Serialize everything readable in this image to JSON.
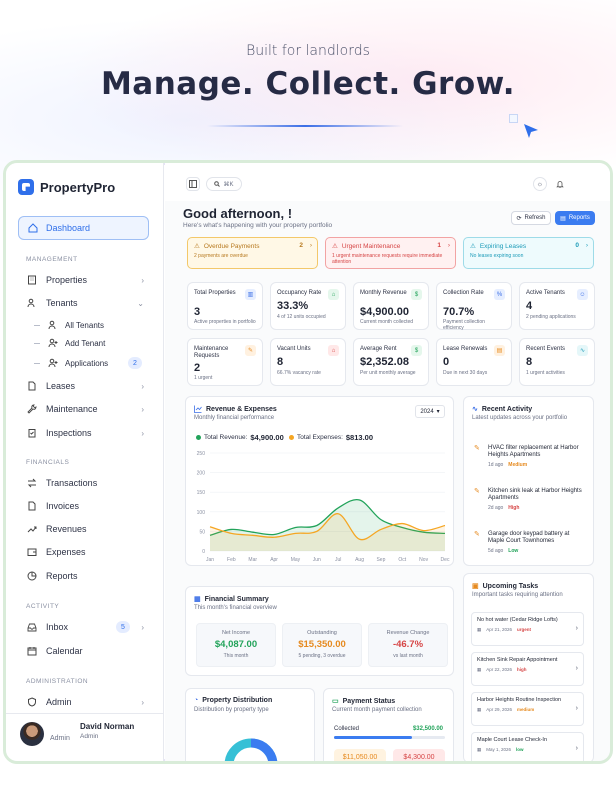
{
  "hero": {
    "subtitle": "Built for landlords",
    "title": "Manage. Collect. Grow."
  },
  "app": {
    "name": "PropertyPro"
  },
  "sidebar": {
    "active_item": "Dashboard",
    "sections": {
      "management": "MANAGEMENT",
      "financials": "FINANCIALS",
      "activity": "ACTIVITY",
      "administration": "ADMINISTRATION"
    },
    "items": {
      "properties": "Properties",
      "tenants": "Tenants",
      "all_tenants": "All Tenants",
      "add_tenant": "Add Tenant",
      "applications": "Applications",
      "applications_count": "2",
      "leases": "Leases",
      "maintenance": "Maintenance",
      "inspections": "Inspections",
      "transactions": "Transactions",
      "invoices": "Invoices",
      "revenues": "Revenues",
      "expenses": "Expenses",
      "reports": "Reports",
      "inbox": "Inbox",
      "inbox_count": "5",
      "calendar": "Calendar",
      "admin": "Admin"
    },
    "user": {
      "name": "David Norman",
      "role": "Admin",
      "role_left": "Admin"
    }
  },
  "topbar": {
    "search_shortcut": "⌘K"
  },
  "header": {
    "greeting": "Good afternoon, !",
    "subtitle": "Here's what's happening with your property portfolio",
    "refresh_label": "Refresh",
    "reports_label": "Reports"
  },
  "alerts": [
    {
      "title": "Overdue Payments",
      "count": "2",
      "sub": "2 payments are overdue",
      "bg": "#fff8e6",
      "border": "#f3c86a",
      "color": "#b7791f"
    },
    {
      "title": "Urgent Maintenance",
      "count": "1",
      "sub": "1 urgent maintenance requests require immediate attention",
      "bg": "#fff1f1",
      "border": "#f2a3a3",
      "color": "#d64545"
    },
    {
      "title": "Expiring Leases",
      "count": "0",
      "sub": "No leases expiring soon",
      "bg": "#eefbfd",
      "border": "#9edbe8",
      "color": "#1b9bb8"
    }
  ],
  "stats": [
    {
      "label": "Total Properties",
      "value": "3",
      "sub": "Active properties in portfolio",
      "icon": "building-icon",
      "icon_bg": "#e6eeff",
      "icon_color": "#3b6ee6"
    },
    {
      "label": "Occupancy Rate",
      "value": "33.3%",
      "sub": "4 of 12 units occupied",
      "icon": "home-icon",
      "icon_bg": "#e5f7ec",
      "icon_color": "#22a35a"
    },
    {
      "label": "Monthly Revenue",
      "value": "$4,900.00",
      "sub": "Current month collected",
      "icon": "dollar-icon",
      "icon_bg": "#e5f7ec",
      "icon_color": "#22a35a"
    },
    {
      "label": "Collection Rate",
      "value": "70.7%",
      "sub": "Payment collection efficiency",
      "icon": "percent-icon",
      "icon_bg": "#e6eeff",
      "icon_color": "#3b6ee6"
    },
    {
      "label": "Active Tenants",
      "value": "4",
      "sub": "2 pending applications",
      "icon": "users-icon",
      "icon_bg": "#e6eeff",
      "icon_color": "#3b6ee6"
    },
    {
      "label": "Maintenance Requests",
      "value": "2",
      "sub": "1 urgent",
      "icon": "wrench-icon",
      "icon_bg": "#fff1e0",
      "icon_color": "#e68a1f"
    },
    {
      "label": "Vacant Units",
      "value": "8",
      "sub": "66.7% vacancy rate",
      "icon": "home-icon",
      "icon_bg": "#ffe8e8",
      "icon_color": "#d64545"
    },
    {
      "label": "Average Rent",
      "value": "$2,352.08",
      "sub": "Per unit monthly average",
      "icon": "dollar-icon",
      "icon_bg": "#e5f7ec",
      "icon_color": "#22a35a"
    },
    {
      "label": "Lease Renewals",
      "value": "0",
      "sub": "Due in next 30 days",
      "icon": "file-icon",
      "icon_bg": "#fff1e0",
      "icon_color": "#e68a1f"
    },
    {
      "label": "Recent Events",
      "value": "8",
      "sub": "1 urgent activities",
      "icon": "activity-icon",
      "icon_bg": "#e5f7f9",
      "icon_color": "#1b9bb8"
    }
  ],
  "revenue_panel": {
    "title": "Revenue & Expenses",
    "subtitle": "Monthly financial performance",
    "year": "2024",
    "legend_revenue_label": "Total Revenue:",
    "legend_revenue_value": "$4,900.00",
    "legend_expenses_label": "Total Expenses:",
    "legend_expenses_value": "$813.00"
  },
  "chart_data": {
    "type": "area",
    "categories": [
      "Jan",
      "Feb",
      "Mar",
      "Apr",
      "May",
      "Jun",
      "Jul",
      "Aug",
      "Sep",
      "Oct",
      "Nov",
      "Dec"
    ],
    "ylim": [
      0,
      250
    ],
    "yticks": [
      0,
      50,
      100,
      150,
      200,
      250
    ],
    "grid": true,
    "series": [
      {
        "name": "Total Revenue",
        "color": "#22a35a",
        "values": [
          40,
          55,
          48,
          42,
          60,
          65,
          110,
          130,
          80,
          60,
          48,
          45
        ]
      },
      {
        "name": "Total Expenses",
        "color": "#f5a623",
        "values": [
          62,
          45,
          40,
          35,
          45,
          50,
          95,
          30,
          55,
          70,
          52,
          65
        ]
      }
    ]
  },
  "recent_activity": {
    "title": "Recent Activity",
    "subtitle": "Latest updates across your portfolio",
    "items": [
      {
        "text": "HVAC filter replacement at Harbor Heights Apartments",
        "time": "1d ago",
        "priority": "Medium",
        "priority_color": "#e68a1f"
      },
      {
        "text": "Kitchen sink leak at Harbor Heights Apartments",
        "time": "2d ago",
        "priority": "High",
        "priority_color": "#d64545"
      },
      {
        "text": "Garage door keypad battery at Maple Court Townhomes",
        "time": "5d ago",
        "priority": "Low",
        "priority_color": "#22a35a"
      }
    ]
  },
  "upcoming_tasks": {
    "title": "Upcoming Tasks",
    "subtitle": "Important tasks requiring attention",
    "items": [
      {
        "title": "No hot water (Cedar Ridge Lofts)",
        "date": "Apr 21, 2026",
        "priority": "urgent",
        "priority_color": "#d64545"
      },
      {
        "title": "Kitchen Sink Repair Appointment",
        "date": "Apr 22, 2026",
        "priority": "high",
        "priority_color": "#d64545"
      },
      {
        "title": "Harbor Heights Routine Inspection",
        "date": "Apr 29, 2026",
        "priority": "medium",
        "priority_color": "#e68a1f"
      },
      {
        "title": "Maple Court Lease Check-In",
        "date": "May 1, 2026",
        "priority": "low",
        "priority_color": "#22a35a"
      }
    ]
  },
  "financial_summary": {
    "title": "Financial Summary",
    "subtitle": "This month's financial overview",
    "cells": [
      {
        "label": "Net Income",
        "value": "$4,087.00",
        "sub": "This month",
        "color": "#22a35a"
      },
      {
        "label": "Outstanding",
        "value": "$15,350.00",
        "sub": "5 pending, 3 overdue",
        "color": "#e68a1f"
      },
      {
        "label": "Revenue Change",
        "value": "-46.7%",
        "sub": "vs last month",
        "color": "#d64545"
      }
    ]
  },
  "property_distribution": {
    "title": "Property Distribution",
    "subtitle": "Distribution by property type"
  },
  "payment_status": {
    "title": "Payment Status",
    "subtitle": "Current month payment collection",
    "collected_label": "Collected",
    "collected_value": "$32,500.00",
    "collected_fraction": 0.7,
    "chip_1": "$11,050.00",
    "chip_2": "$4,300.00"
  }
}
